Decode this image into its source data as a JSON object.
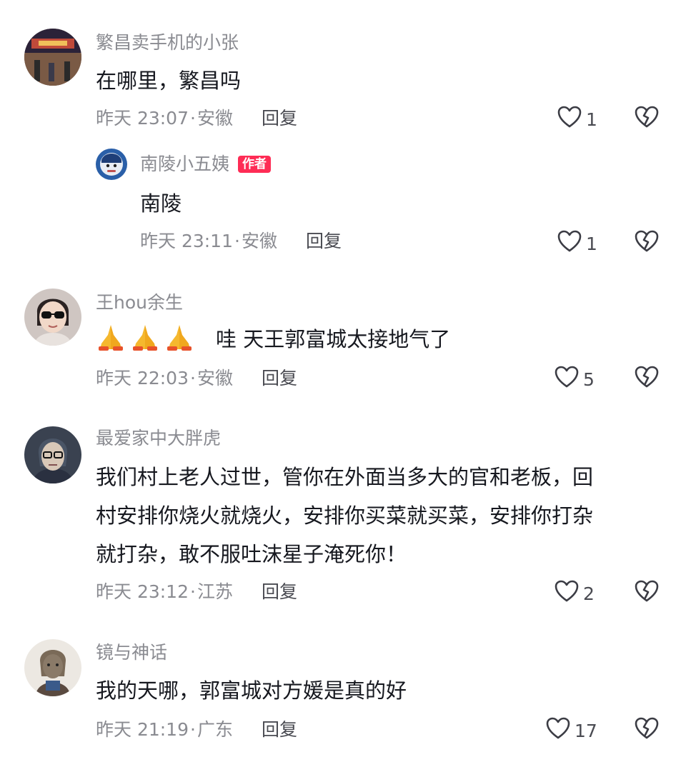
{
  "comments": [
    {
      "username": "繁昌卖手机的小张",
      "text": "在哪里，繁昌吗",
      "time": "昨天 23:07",
      "location": "安徽",
      "reply_label": "回复",
      "likes": "1"
    },
    {
      "username": "南陵小五姨",
      "badge": "作者",
      "text": "南陵",
      "time": "昨天 23:11",
      "location": "安徽",
      "reply_label": "回复",
      "likes": "1"
    },
    {
      "username": "王hou余生",
      "emoji_names": [
        "folded-hands-emoji",
        "folded-hands-emoji",
        "folded-hands-emoji"
      ],
      "text": "哇 天王郭富城太接地气了",
      "time": "昨天 22:03",
      "location": "安徽",
      "reply_label": "回复",
      "likes": "5"
    },
    {
      "username": "最爱家中大胖虎",
      "text_lines": [
        "我们村上老人过世，管你在外面当多大的官和老板，回",
        "村安排你烧火就烧火，安排你买菜就买菜，安排你打杂",
        "就打杂，敢不服吐沫星子淹死你！"
      ],
      "time": "昨天 23:12",
      "location": "江苏",
      "reply_label": "回复",
      "likes": "2"
    },
    {
      "username": "镜与神话",
      "text": "我的天哪，郭富城对方媛是真的好",
      "time": "昨天 21:19",
      "location": "广东",
      "reply_label": "回复",
      "likes": "17"
    }
  ],
  "icons": {
    "like": "heart-outline-icon",
    "dislike": "broken-heart-icon"
  },
  "colors": {
    "author_badge": "#fe2c55",
    "secondary_text": "#8a8b91",
    "primary_text": "#16181f"
  }
}
